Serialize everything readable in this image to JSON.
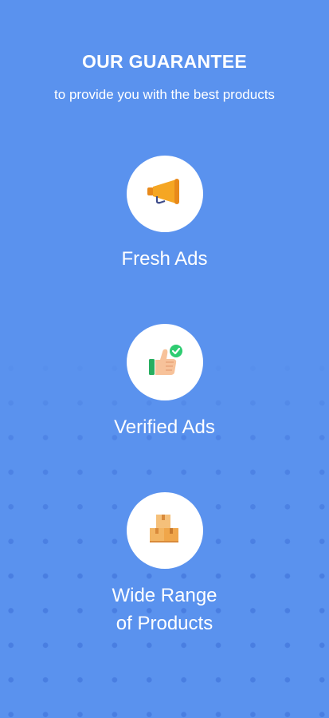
{
  "header": {
    "title": "OUR GUARANTEE",
    "subtitle": "to provide you with the best products"
  },
  "features": [
    {
      "label": "Fresh Ads",
      "icon": "megaphone-icon"
    },
    {
      "label": "Verified Ads",
      "icon": "verified-thumbs-up-icon"
    },
    {
      "label_line1": "Wide Range",
      "label_line2": "of Products",
      "icon": "boxes-icon"
    }
  ],
  "colors": {
    "background": "#5a92ee",
    "dots": "#3c6ed7",
    "circle": "#ffffff",
    "accent_orange": "#f5a623",
    "accent_green": "#2ecc71"
  }
}
